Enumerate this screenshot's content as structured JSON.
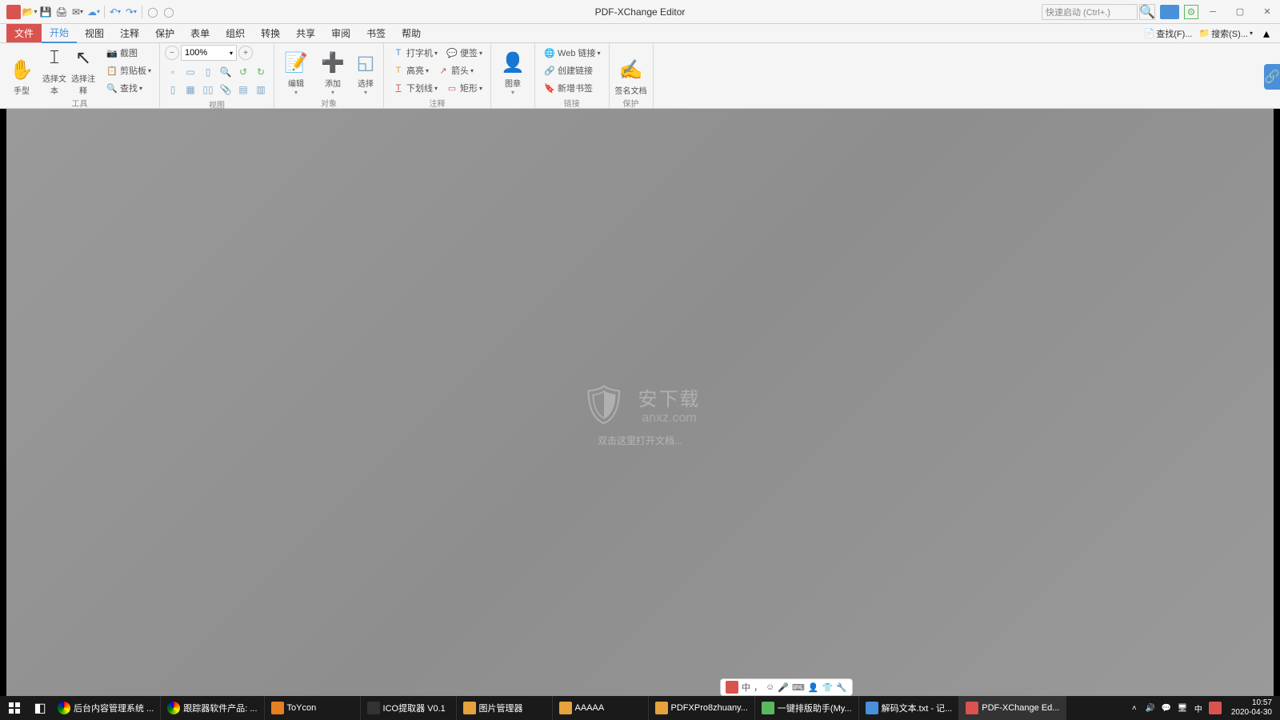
{
  "app": {
    "title": "PDF-XChange Editor"
  },
  "titlebar": {
    "quick_launch_placeholder": "快速启动 (Ctrl+.)"
  },
  "menu": {
    "file": "文件",
    "start": "开始",
    "view": "视图",
    "comment": "注释",
    "protect": "保护",
    "form": "表单",
    "organize": "组织",
    "convert": "转换",
    "share": "共享",
    "review": "审阅",
    "bookmark": "书签",
    "help": "帮助",
    "find": "查找(F)...",
    "search": "搜索(S)..."
  },
  "ribbon": {
    "tools": {
      "hand": "手型",
      "select_text": "选择文本",
      "select_annot": "选择注释",
      "group": "工具"
    },
    "clip": {
      "snapshot": "截图",
      "clipboard": "剪贴板",
      "find": "查找"
    },
    "view": {
      "zoom_value": "100%",
      "group": "视图"
    },
    "object": {
      "edit": "编辑",
      "add": "添加",
      "select": "选择",
      "group": "对象"
    },
    "annot": {
      "typewriter": "打字机",
      "note": "便签",
      "highlight": "高亮",
      "arrow": "箭头",
      "underline": "下划线",
      "rect": "矩形",
      "group": "注释"
    },
    "stamp": {
      "stamp": "图章"
    },
    "link": {
      "web": "Web 链接",
      "create": "创建链接",
      "bookmark": "新增书签",
      "group": "链接"
    },
    "protect": {
      "sign": "签名文档",
      "group": "保护"
    }
  },
  "canvas": {
    "watermark_text": "安下载",
    "watermark_url": "anxz.com",
    "hint": "双击这里打开文档..."
  },
  "ime": {
    "lang": "中",
    "punct": "，"
  },
  "taskbar": {
    "items": [
      "后台内容管理系统 ...",
      "跟踪器软件产品: ...",
      "ToYcon",
      "ICO提取器 V0.1",
      "图片管理器",
      "AAAAA",
      "PDFXPro8zhuany...",
      "一键排版助手(My...",
      "解码文本.txt - 记...",
      "PDF-XChange Ed..."
    ],
    "time": "10:57",
    "date": "2020-04-30"
  }
}
